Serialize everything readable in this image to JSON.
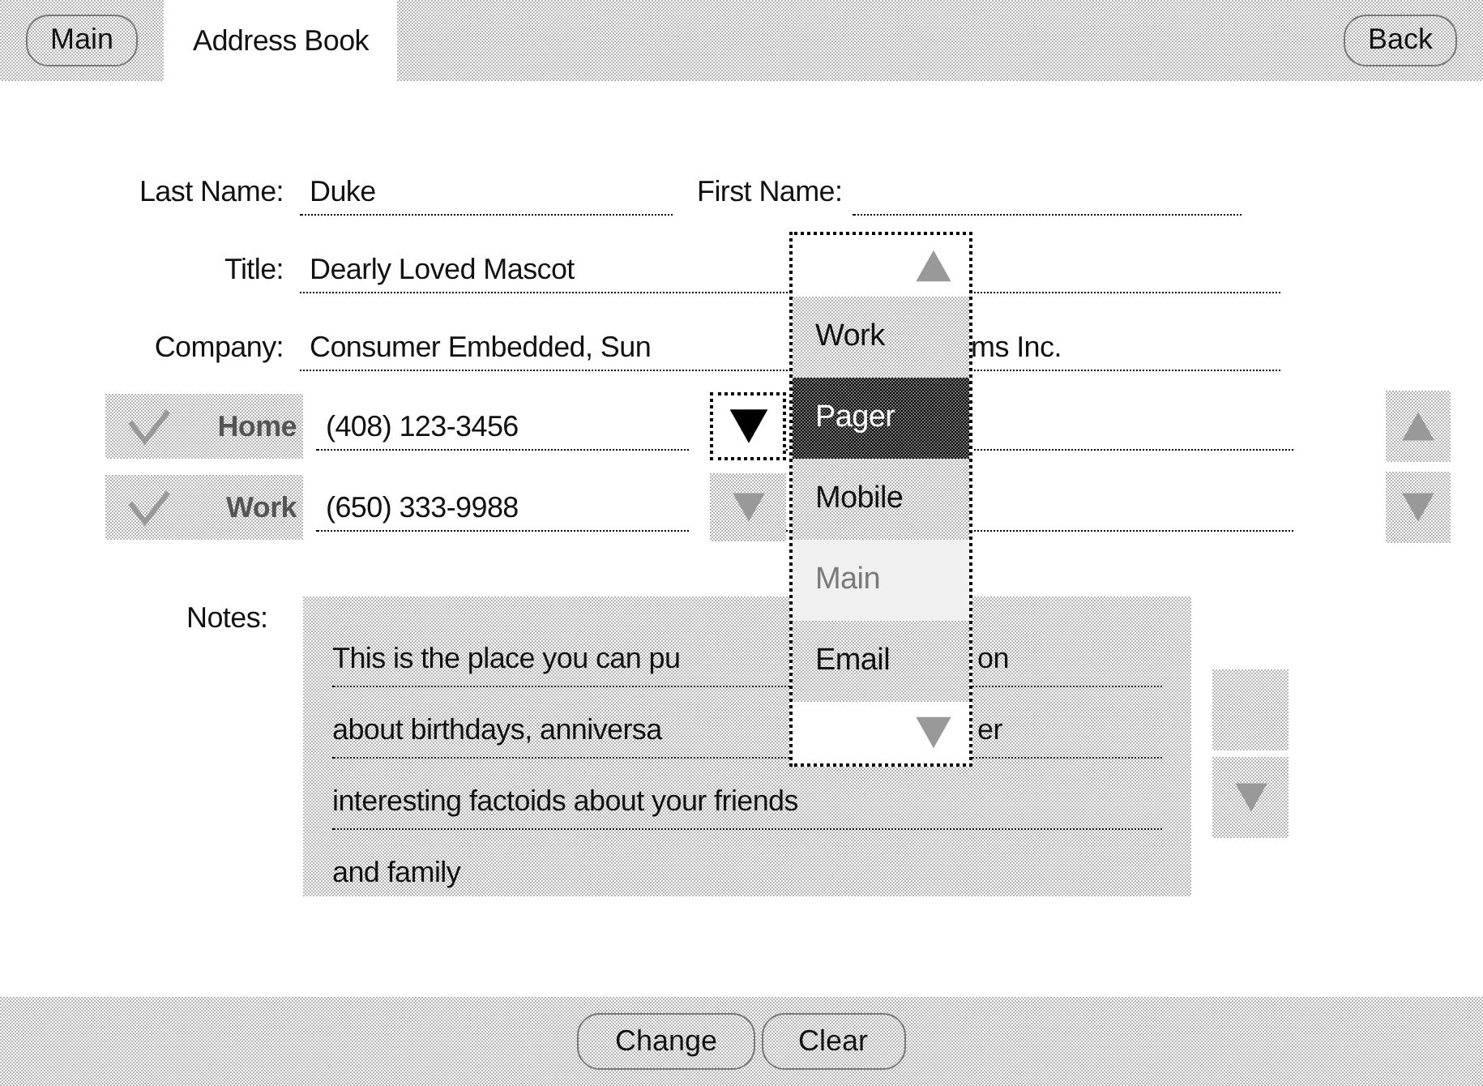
{
  "header": {
    "main_button": "Main",
    "title": "Address Book",
    "back_button": "Back"
  },
  "last_name": {
    "label": "Last Name:",
    "value": "Duke"
  },
  "first_name": {
    "label": "First Name:"
  },
  "title_field": {
    "label": "Title:",
    "value": "Dearly Loved Mascot"
  },
  "company": {
    "label": "Company:",
    "value_parts": [
      "Consumer Embedded, Sun",
      "ms Inc."
    ]
  },
  "phones": [
    {
      "type": "Home",
      "number": "(408) 123-3456",
      "menu_open": true
    },
    {
      "type": "Work",
      "number": "(650) 333-9988",
      "menu_open": false
    }
  ],
  "type_menu": {
    "items": [
      {
        "label": "Work",
        "selected": false,
        "disabled": false
      },
      {
        "label": "Pager",
        "selected": true,
        "disabled": false
      },
      {
        "label": "Mobile",
        "selected": false,
        "disabled": false
      },
      {
        "label": "Main",
        "selected": false,
        "disabled": true
      },
      {
        "label": "Email",
        "selected": false,
        "disabled": false
      }
    ]
  },
  "notes": {
    "label": "Notes:",
    "lines": [
      {
        "parts": [
          "This is the place you can pu",
          "on"
        ]
      },
      {
        "parts": [
          "about birthdays, anniversa",
          "er"
        ]
      },
      {
        "parts": [
          "interesting factoids about your friends"
        ]
      },
      {
        "parts": [
          "and family"
        ]
      }
    ],
    "can_scroll_up": false,
    "can_scroll_down": true
  },
  "buttons": [
    "Change",
    "Clear"
  ]
}
